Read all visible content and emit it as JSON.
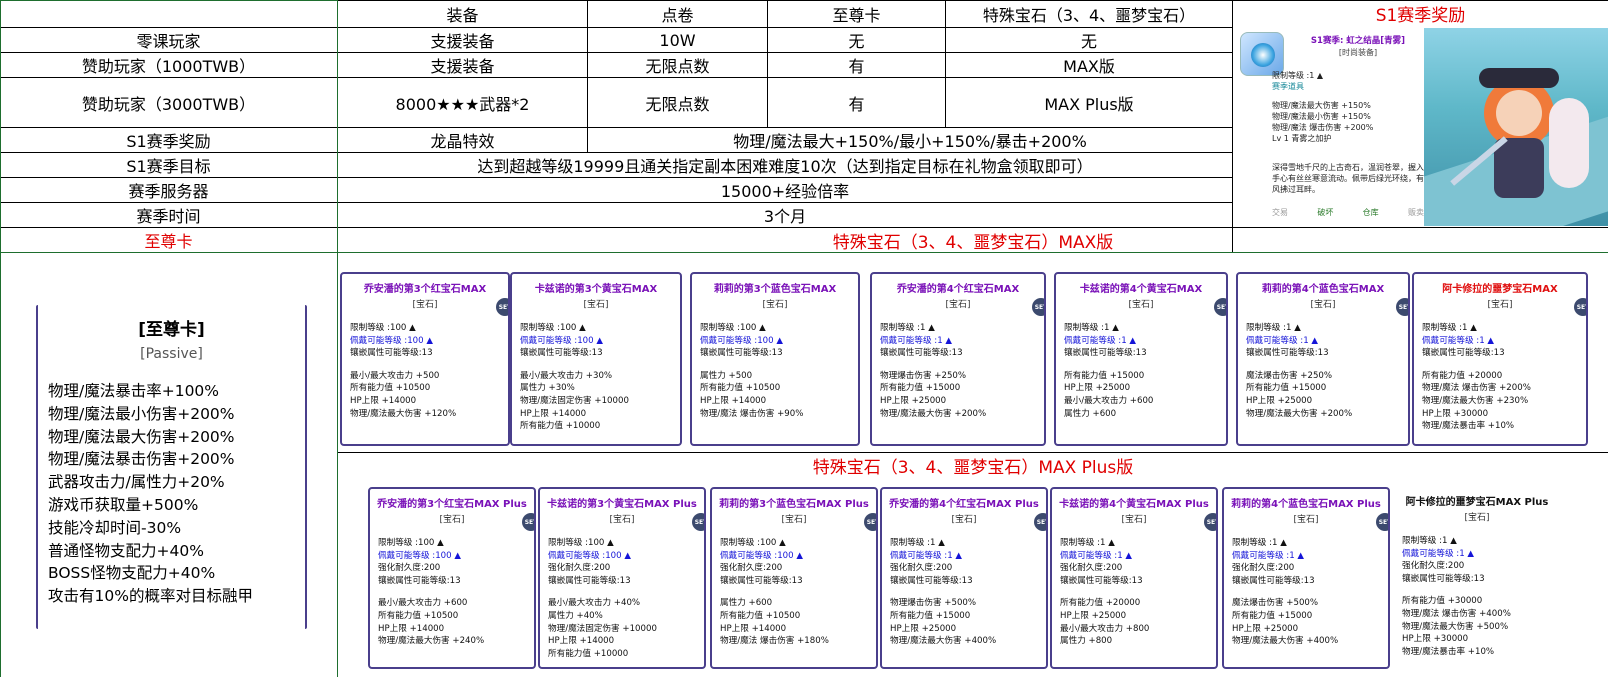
{
  "table": {
    "header": [
      "装备",
      "点卷",
      "至尊卡",
      "特殊宝石（3、4、噩梦宝石）"
    ],
    "rows": [
      {
        "label": "零课玩家",
        "cells": [
          "支援装备",
          "10W",
          "无",
          "无"
        ]
      },
      {
        "label": "赞助玩家（1000TWB）",
        "cells": [
          "支援装备",
          "无限点数",
          "有",
          "MAX版"
        ]
      },
      {
        "label": "赞助玩家（3000TWB）",
        "cells": [
          "8000★★★武器*2",
          "无限点数",
          "有",
          "MAX Plus版"
        ]
      }
    ],
    "season_reward": {
      "label": "S1赛季奖励",
      "col1": "龙晶特效",
      "col2": "物理/魔法最大+150%/最小+150%/暴击+200%"
    },
    "season_goal": {
      "label": "S1赛季目标",
      "value": "达到超越等级19999且通关指定副本困难难度10次（达到指定目标在礼物盒领取即可）"
    },
    "season_server": {
      "label": "赛季服务器",
      "value": "15000+经验倍率"
    },
    "season_time": {
      "label": "赛季时间",
      "value": "3个月"
    }
  },
  "reward_panel": {
    "title": "S1赛季奖励",
    "item_name": "S1赛季: 虹之结晶[青雾]",
    "item_type": "[时尚装备]",
    "lines": [
      "限制等级 :1 ▲",
      "赛季道具",
      "物理/魔法最大伤害 +150%",
      "物理/魔法最小伤害 +150%",
      "物理/魔法 爆击伤害 +200%",
      "Lv 1 青雾之加护"
    ],
    "desc": "深得雪地千尺的上古奇石，温润苍翠，握入手心有丝丝寒意流动。佩带后绿光环绕，有风拂过耳畔。",
    "actions": [
      "交易",
      "破坏",
      "仓库",
      "贩卖"
    ]
  },
  "supreme_card": {
    "section_label": "至尊卡",
    "title": "[至尊卡]",
    "subtitle": "[Passive]",
    "lines": [
      "物理/魔法暴击率+100%",
      "物理/魔法最小伤害+200%",
      "物理/魔法最大伤害+200%",
      "物理/魔法暴击伤害+200%",
      "武器攻击力/属性力+20%",
      "游戏币获取量+500%",
      "技能冷却时间-30%",
      "普通怪物支配力+40%",
      "BOSS怪物支配力+40%",
      "攻击有10%的概率对目标融甲"
    ]
  },
  "max_section": {
    "title": "特殊宝石（3、4、噩梦宝石）MAX版",
    "cards": [
      {
        "name": "乔安潘的第3个红宝石MAX",
        "color": "purple",
        "type": "[宝石]",
        "req": [
          "限制等级 :100 ▲",
          "佩戴可能等级 :100 ▲",
          "镶嵌属性可能等级:13"
        ],
        "stats": [
          "最小/最大攻击力 +500",
          "所有能力值 +10500",
          "HP上限 +14000",
          "物理/魔法最大伤害 +120%"
        ],
        "set": true
      },
      {
        "name": "卡兹诺的第3个黄宝石MAX",
        "color": "purple",
        "type": "[宝石]",
        "req": [
          "限制等级 :100 ▲",
          "佩戴可能等级 :100 ▲",
          "镶嵌属性可能等级:13"
        ],
        "stats": [
          "最小/最大攻击力 +30%",
          "属性力 +30%",
          "物理/魔法固定伤害 +10000",
          "HP上限 +14000",
          "所有能力值 +10000"
        ],
        "set": false
      },
      {
        "name": "莉莉的第3个蓝色宝石MAX",
        "color": "purple",
        "type": "[宝石]",
        "req": [
          "限制等级 :100 ▲",
          "佩戴可能等级 :100 ▲",
          "镶嵌属性可能等级:13"
        ],
        "stats": [
          "属性力 +500",
          "所有能力值 +10500",
          "HP上限 +14000",
          "物理/魔法 爆击伤害 +90%"
        ],
        "set": false
      },
      {
        "name": "乔安潘的第4个红宝石MAX",
        "color": "purple",
        "type": "[宝石]",
        "req": [
          "限制等级 :1 ▲",
          "佩戴可能等级 :1 ▲",
          "镶嵌属性可能等级:13"
        ],
        "stats": [
          "物理爆击伤害 +250%",
          "所有能力值 +15000",
          "HP上限 +25000",
          "物理/魔法最大伤害 +200%"
        ],
        "set": true
      },
      {
        "name": "卡兹诺的第4个黄宝石MAX",
        "color": "purple",
        "type": "[宝石]",
        "req": [
          "限制等级 :1 ▲",
          "佩戴可能等级 :1 ▲",
          "镶嵌属性可能等级:13"
        ],
        "stats": [
          "所有能力值 +15000",
          "HP上限 +25000",
          "最小/最大攻击力 +600",
          "属性力 +600"
        ],
        "set": true
      },
      {
        "name": "莉莉的第4个蓝色宝石MAX",
        "color": "purple",
        "type": "[宝石]",
        "req": [
          "限制等级 :1 ▲",
          "佩戴可能等级 :1 ▲",
          "镶嵌属性可能等级:13"
        ],
        "stats": [
          "魔法爆击伤害 +250%",
          "所有能力值 +15000",
          "HP上限 +25000",
          "物理/魔法最大伤害 +200%"
        ],
        "set": true
      },
      {
        "name": "阿卡修拉的噩梦宝石MAX",
        "color": "red",
        "type": "[宝石]",
        "req": [
          "限制等级 :1 ▲",
          "佩戴可能等级 :1 ▲",
          "镶嵌属性可能等级:13"
        ],
        "stats": [
          "所有能力值 +20000",
          "物理/魔法 爆击伤害 +200%",
          "物理/魔法最大伤害 +230%",
          "HP上限 +30000",
          "物理/魔法暴击率 +10%"
        ],
        "set": true
      }
    ]
  },
  "plus_section": {
    "title": "特殊宝石（3、4、噩梦宝石）MAX Plus版",
    "cards": [
      {
        "name": "乔安潘的第3个红宝石MAX Plus",
        "color": "purple",
        "type": "[宝石]",
        "req": [
          "限制等级 :100 ▲",
          "佩戴可能等级 :100 ▲",
          "强化耐久度:200",
          "镶嵌属性可能等级:13"
        ],
        "stats": [
          "最小/最大攻击力 +600",
          "所有能力值 +10500",
          "HP上限 +14000",
          "物理/魔法最大伤害 +240%"
        ],
        "set": true
      },
      {
        "name": "卡兹诺的第3个黄宝石MAX Plus",
        "color": "purple",
        "type": "[宝石]",
        "req": [
          "限制等级 :100 ▲",
          "佩戴可能等级 :100 ▲",
          "强化耐久度:200",
          "镶嵌属性可能等级:13"
        ],
        "stats": [
          "最小/最大攻击力 +40%",
          "属性力 +40%",
          "物理/魔法固定伤害 +10000",
          "HP上限 +14000",
          "所有能力值 +10000"
        ],
        "set": true
      },
      {
        "name": "莉莉的第3个蓝色宝石MAX Plus",
        "color": "purple",
        "type": "[宝石]",
        "req": [
          "限制等级 :100 ▲",
          "佩戴可能等级 :100 ▲",
          "强化耐久度:200",
          "镶嵌属性可能等级:13"
        ],
        "stats": [
          "属性力 +600",
          "所有能力值 +10500",
          "HP上限 +14000",
          "物理/魔法 爆击伤害 +180%"
        ],
        "set": true
      },
      {
        "name": "乔安潘的第4个红宝石MAX Plus",
        "color": "purple",
        "type": "[宝石]",
        "req": [
          "限制等级 :1 ▲",
          "佩戴可能等级 :1 ▲",
          "强化耐久度:200",
          "镶嵌属性可能等级:13"
        ],
        "stats": [
          "物理爆击伤害 +500%",
          "所有能力值 +15000",
          "HP上限 +25000",
          "物理/魔法最大伤害 +400%"
        ],
        "set": true
      },
      {
        "name": "卡兹诺的第4个黄宝石MAX Plus",
        "color": "purple",
        "type": "[宝石]",
        "req": [
          "限制等级 :1 ▲",
          "佩戴可能等级 :1 ▲",
          "强化耐久度:200",
          "镶嵌属性可能等级:13"
        ],
        "stats": [
          "所有能力值 +20000",
          "HP上限 +25000",
          "最小/最大攻击力 +800",
          "属性力 +800"
        ],
        "set": true
      },
      {
        "name": "莉莉的第4个蓝色宝石MAX Plus",
        "color": "purple",
        "type": "[宝石]",
        "req": [
          "限制等级 :1 ▲",
          "佩戴可能等级 :1 ▲",
          "强化耐久度:200",
          "镶嵌属性可能等级:13"
        ],
        "stats": [
          "魔法爆击伤害 +500%",
          "所有能力值 +15000",
          "HP上限 +25000",
          "物理/魔法最大伤害 +400%"
        ],
        "set": true
      },
      {
        "name": "阿卡修拉的噩梦宝石MAX Plus",
        "color": "black",
        "type": "[宝石]",
        "req": [
          "限制等级 :1 ▲",
          "佩戴可能等级 :1 ▲",
          "强化耐久度:200",
          "镶嵌属性可能等级:13"
        ],
        "stats": [
          "所有能力值 +30000",
          "物理/魔法 爆击伤害 +400%",
          "物理/魔法最大伤害 +500%",
          "HP上限 +30000",
          "物理/魔法暴击率 +10%"
        ],
        "set": false
      }
    ]
  },
  "colors": {
    "red": "#e00000",
    "purple": "#7a12b8",
    "blue": "#1515d8",
    "border": "#4a3f8c"
  }
}
